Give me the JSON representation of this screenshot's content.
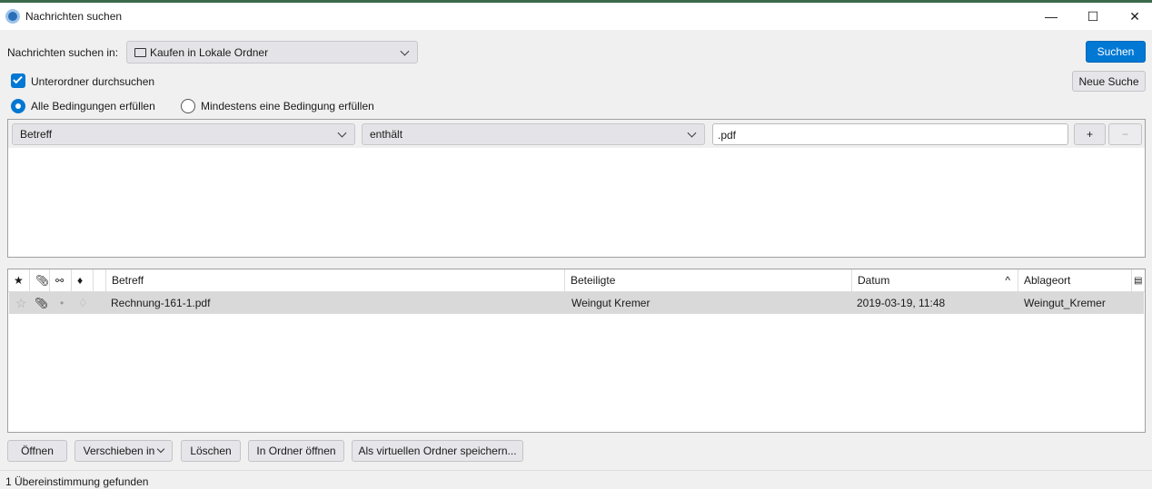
{
  "window": {
    "title": "Nachrichten suchen",
    "minimize": "—",
    "maximize": "☐",
    "close": "✕"
  },
  "search": {
    "in_label": "Nachrichten suchen in:",
    "folder": "Kaufen in Lokale Ordner",
    "search_button": "Suchen",
    "new_search_button": "Neue Suche",
    "subfolders_label": "Unterordner durchsuchen",
    "subfolders_checked": true,
    "match_all_label": "Alle Bedingungen erfüllen",
    "match_any_label": "Mindestens eine Bedingung erfüllen",
    "match_mode": "all"
  },
  "criteria": [
    {
      "field": "Betreff",
      "operator": "enthält",
      "value": ".pdf",
      "add": "+",
      "remove": "−"
    }
  ],
  "results": {
    "columns": [
      "Betreff",
      "Beteiligte",
      "Datum",
      "Ablageort"
    ],
    "rows": [
      {
        "subject": "Rechnung-161-1.pdf",
        "correspondents": "Weingut Kremer",
        "date": "2019-03-19, 11:48",
        "location": "Weingut_Kremer"
      }
    ]
  },
  "actions": {
    "open": "Öffnen",
    "move": "Verschieben in",
    "delete": "Löschen",
    "open_folder": "In Ordner öffnen",
    "save_virtual": "Als virtuellen Ordner speichern..."
  },
  "status": "1 Übereinstimmung gefunden",
  "colors": {
    "accent": "#0078d4",
    "selected_row": "#d9d9d9"
  }
}
